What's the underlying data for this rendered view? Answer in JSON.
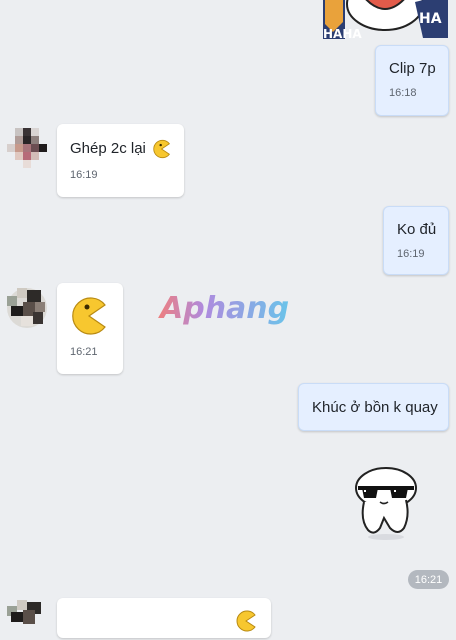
{
  "messages": [
    {
      "text": "Clip 7p",
      "time": "16:18"
    },
    {
      "text": "Ghép 2c lại",
      "time": "16:19"
    },
    {
      "text": "Ko đủ",
      "time": "16:19"
    },
    {
      "time": "16:21"
    },
    {
      "text": "Khúc ở bồn k quay"
    }
  ],
  "sticker_time": "16:21",
  "watermark": "Aphang",
  "sticker_top_text": [
    "HAHA",
    "HA"
  ]
}
